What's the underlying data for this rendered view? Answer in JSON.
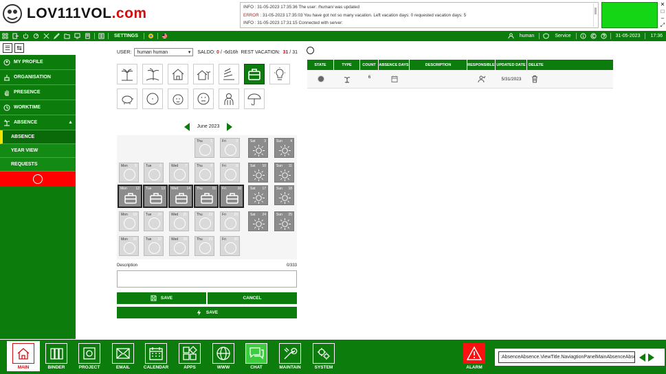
{
  "logo": {
    "text": "LOV111VOL",
    "domain": ".com"
  },
  "log": [
    {
      "level": "INFO",
      "text": " : 31-05-2023 17:35:36 The user: /human/ was updated"
    },
    {
      "level": "ERROR",
      "text": " : 31-05-2023 17:35:03 You have got not so many vacation. Left vacation days:  0 requested vacation days:  5"
    },
    {
      "level": "INFO",
      "text": " : 31-05-2023 17:31:15 Connected with server:"
    }
  ],
  "toolbar": {
    "settings": "SETTINGS",
    "user": "human",
    "service": "Service",
    "date": "31-05-2023",
    "time": "17:36"
  },
  "sidebar": {
    "items": [
      {
        "label": "MY PROFILE",
        "icon": "person-icon"
      },
      {
        "label": "ORGANISATION",
        "icon": "org-icon"
      },
      {
        "label": "PRESENCE",
        "icon": "hand-icon"
      },
      {
        "label": "WORKTIME",
        "icon": "clock-icon"
      },
      {
        "label": "ABSENCE",
        "icon": "palm-icon"
      }
    ],
    "sub": [
      "ABSENCE",
      "YEAR VIEW",
      "REQUESTS"
    ]
  },
  "form": {
    "user_label": "USER:",
    "user_value": "human human",
    "saldo_label": "SALDO:",
    "saldo_value": "0",
    "saldo_sep": "/",
    "saldo_extra": "-6d16h",
    "rest_label": "REST VACATION:",
    "rest_value": "31",
    "rest_sep": "/",
    "rest_total": "31"
  },
  "calendar": {
    "month": "June 2023",
    "days": [
      {
        "d": "Thu",
        "n": "1"
      },
      {
        "d": "Fri",
        "n": "2"
      },
      {
        "d": "Sat",
        "n": "3"
      },
      {
        "d": "Sun",
        "n": "4"
      },
      {
        "d": "Mon",
        "n": "5"
      },
      {
        "d": "Tue",
        "n": "6"
      },
      {
        "d": "Wed",
        "n": "7"
      },
      {
        "d": "Thu",
        "n": "8"
      },
      {
        "d": "Fri",
        "n": "9"
      },
      {
        "d": "Sat",
        "n": "10"
      },
      {
        "d": "Sun",
        "n": "11"
      },
      {
        "d": "Mon",
        "n": "12"
      },
      {
        "d": "Tue",
        "n": "13"
      },
      {
        "d": "Wed",
        "n": "14"
      },
      {
        "d": "Thu",
        "n": "15"
      },
      {
        "d": "Fri",
        "n": "16"
      },
      {
        "d": "Sat",
        "n": "17"
      },
      {
        "d": "Sun",
        "n": "18"
      },
      {
        "d": "Mon",
        "n": "19"
      },
      {
        "d": "Tue",
        "n": "20"
      },
      {
        "d": "Wed",
        "n": "21"
      },
      {
        "d": "Thu",
        "n": "22"
      },
      {
        "d": "Fri",
        "n": "23"
      },
      {
        "d": "Sat",
        "n": "24"
      },
      {
        "d": "Sun",
        "n": "25"
      },
      {
        "d": "Mon",
        "n": "26"
      },
      {
        "d": "Tue",
        "n": "27"
      },
      {
        "d": "Wed",
        "n": "28"
      },
      {
        "d": "Thu",
        "n": "29"
      },
      {
        "d": "Fri",
        "n": "30"
      }
    ]
  },
  "description": {
    "label": "Description",
    "count": "0/333"
  },
  "buttons": {
    "save": "SAVE",
    "cancel": "CANCEL",
    "save2": "SAVE"
  },
  "table": {
    "headers": [
      "STATE",
      "TYPE",
      "COUNT",
      "ABSENCE DAYS",
      "DESCRIPTION",
      "RESPONSIBLE",
      "UPDATED DATE",
      "DELETE"
    ],
    "rows": [
      {
        "count": "6",
        "updated": "5/31/2023"
      }
    ]
  },
  "bottom": [
    {
      "label": "MAIN",
      "icon": "house-icon"
    },
    {
      "label": "BINDER",
      "icon": "binder-icon"
    },
    {
      "label": "PROJECT",
      "icon": "project-icon"
    },
    {
      "label": "EMAIL",
      "icon": "email-icon"
    },
    {
      "label": "CALENDAR",
      "icon": "calendar-icon"
    },
    {
      "label": "APPS",
      "icon": "apps-icon"
    },
    {
      "label": "WWW",
      "icon": "globe-icon"
    },
    {
      "label": "CHAT",
      "icon": "chat-icon"
    },
    {
      "label": "MAINTAIN",
      "icon": "tools-icon"
    },
    {
      "label": "SYSTEM",
      "icon": "gears-icon"
    }
  ],
  "alarm": "ALARM",
  "address": ":AbsenceAbsence.ViewTitle.NaviagtionPanelMainAbsenceAbsence:",
  "colors": {
    "green": "#0c7c0c",
    "red": "#ff0000",
    "bright_green": "#14d614"
  }
}
